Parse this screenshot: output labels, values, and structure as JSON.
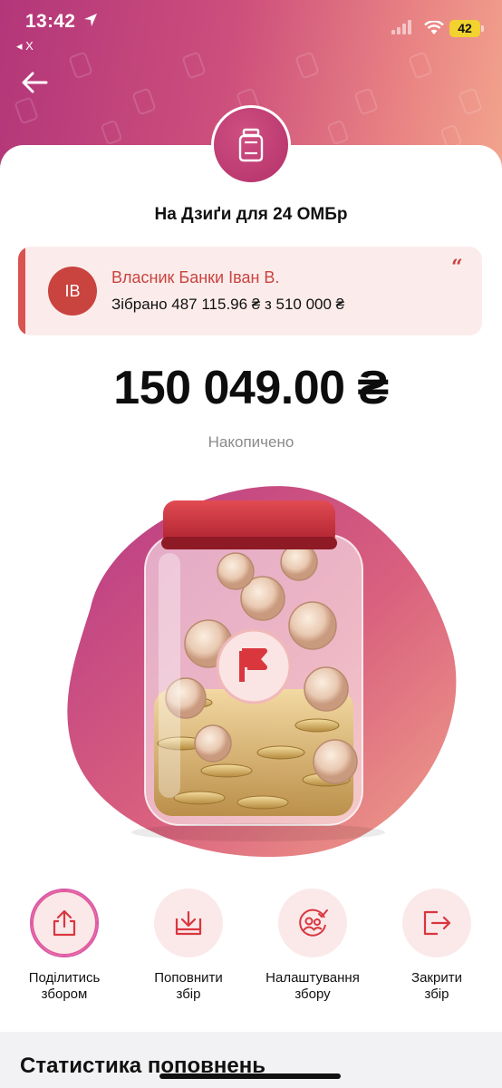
{
  "status_bar": {
    "time": "13:42",
    "back_app": "◂ X",
    "battery": "42"
  },
  "header": {
    "back_icon": "arrow-left-icon"
  },
  "jar": {
    "icon": "jar-icon",
    "title": "На Дзиґи для 24 ОМБр",
    "owner_initials": "ІВ",
    "owner_name": "Власник Банки Іван В.",
    "collected_text": "Зібрано 487 115.96 ₴ з 510 000 ₴",
    "balance": "150 049.00 ₴",
    "balance_label": "Накопичено"
  },
  "actions": [
    {
      "label_line1": "Поділитись",
      "label_line2": "збором",
      "icon": "share-icon"
    },
    {
      "label_line1": "Поповнити",
      "label_line2": "збір",
      "icon": "top-up-icon"
    },
    {
      "label_line1": "Налаштування",
      "label_line2": "збору",
      "icon": "settings-icon"
    },
    {
      "label_line1": "Закрити",
      "label_line2": "збір",
      "icon": "close-jar-icon"
    }
  ],
  "stats": {
    "title": "Статистика поповнень"
  },
  "colors": {
    "accent": "#c9433f",
    "header_start": "#b2367a",
    "header_end": "#f2a58e",
    "card_bg": "#fbeceb"
  }
}
